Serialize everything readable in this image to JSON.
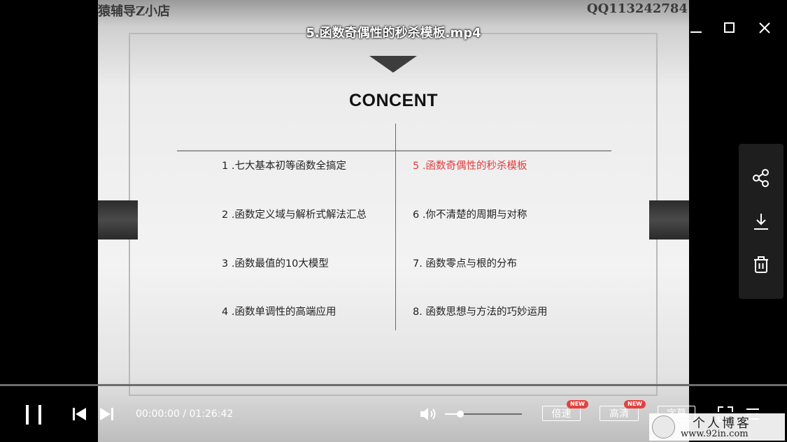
{
  "window": {
    "title": "5.函数奇偶性的秒杀模板.mp4",
    "controls": [
      "minimize-icon",
      "maximize-icon",
      "close-icon"
    ]
  },
  "slide": {
    "watermark_left": "猿辅导Z小店",
    "watermark_right": "QQ113242784",
    "heading": "CONCENT",
    "left_items": [
      "1 .七大基本初等函数全搞定",
      "2 .函数定义域与解析式解法汇总",
      "3 .函数最值的10大模型",
      "4 .函数单调性的高端应用"
    ],
    "right_items": [
      "5 .函数奇偶性的秒杀模板",
      "6 .你不清楚的周期与对称",
      "7. 函数零点与根的分布",
      "8. 函数思想与方法的巧妙运用"
    ],
    "active_item": "5 .函数奇偶性的秒杀模板",
    "active_color": "#e23b3b"
  },
  "side_panel": {
    "buttons": [
      "share-icon",
      "download-icon",
      "delete-icon"
    ]
  },
  "player": {
    "progress": 0.0,
    "volume": 0.2,
    "time": "00:00:00 / 01:26:42",
    "speed_label": "倍速",
    "quality_label": "高清",
    "subtitle_label": "字幕",
    "new_badge": "NEW",
    "icons": [
      "pause-icon",
      "previous-icon",
      "next-icon",
      "volume-icon",
      "fullscreen-icon",
      "playlist-icon"
    ]
  },
  "blog_watermark": {
    "name": "个人博客",
    "url": "www.92in.com"
  }
}
